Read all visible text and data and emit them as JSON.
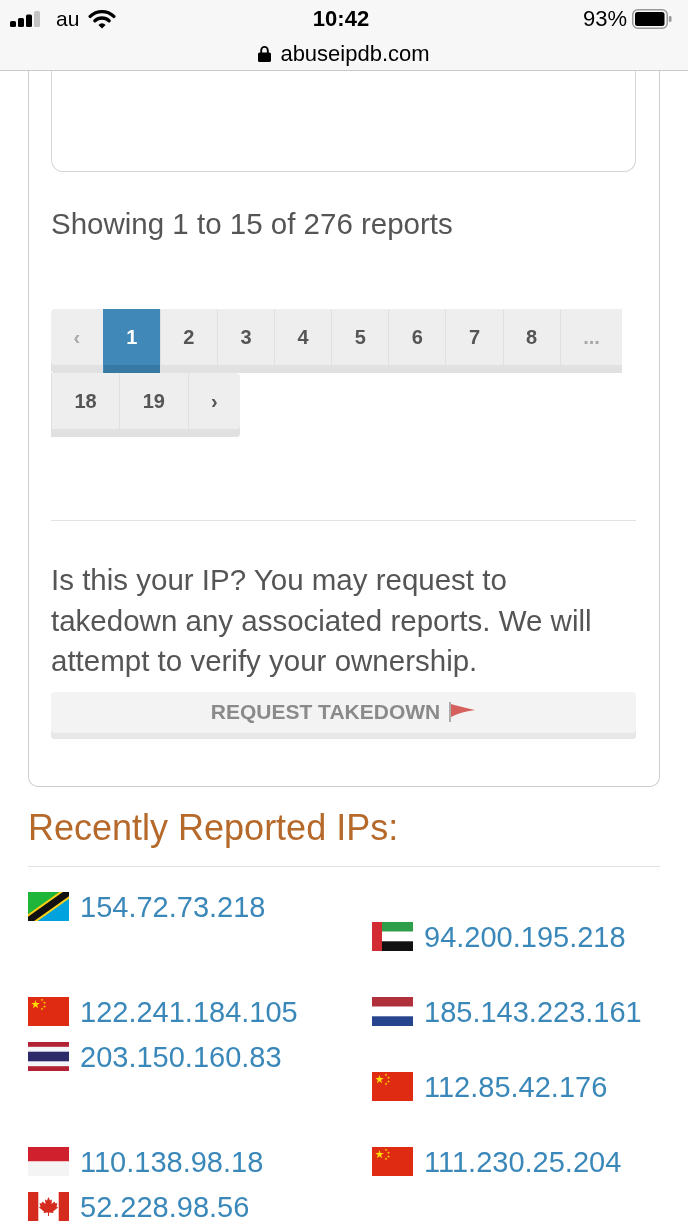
{
  "status_bar": {
    "carrier": "au",
    "time": "10:42",
    "battery": "93%"
  },
  "address_bar": {
    "url": "abuseipdb.com"
  },
  "reports": {
    "summary": "Showing 1 to 15 of 276 reports",
    "pagination": [
      {
        "label": "‹",
        "selected": false,
        "disabled": true
      },
      {
        "label": "1",
        "selected": true,
        "disabled": false
      },
      {
        "label": "2",
        "selected": false,
        "disabled": false
      },
      {
        "label": "3",
        "selected": false,
        "disabled": false
      },
      {
        "label": "4",
        "selected": false,
        "disabled": false
      },
      {
        "label": "5",
        "selected": false,
        "disabled": false
      },
      {
        "label": "6",
        "selected": false,
        "disabled": false
      },
      {
        "label": "7",
        "selected": false,
        "disabled": false
      },
      {
        "label": "8",
        "selected": false,
        "disabled": false
      },
      {
        "label": "...",
        "selected": false,
        "disabled": true
      },
      {
        "label": "18",
        "selected": false,
        "disabled": false
      },
      {
        "label": "19",
        "selected": false,
        "disabled": false
      },
      {
        "label": "›",
        "selected": false,
        "disabled": false
      }
    ]
  },
  "takedown": {
    "text": "Is this your IP? You may request to takedown any associated reports. We will attempt to verify your ownership.",
    "button": "REQUEST TAKEDOWN"
  },
  "recently_reported": {
    "title": "Recently Reported IPs:",
    "ips": [
      {
        "kind": "tz",
        "address": "154.72.73.218"
      },
      {
        "kind": "ae",
        "address": "94.200.195.218"
      },
      {
        "kind": "cn",
        "address": "122.241.184.105"
      },
      {
        "kind": "nl",
        "address": "185.143.223.161"
      },
      {
        "kind": "th",
        "address": "203.150.160.83"
      },
      {
        "kind": "cn",
        "address": "112.85.42.176"
      },
      {
        "kind": "id",
        "address": "110.138.98.18"
      },
      {
        "kind": "cn",
        "address": "111.230.25.204"
      },
      {
        "kind": "ca",
        "address": "52.228.98.56"
      }
    ]
  }
}
